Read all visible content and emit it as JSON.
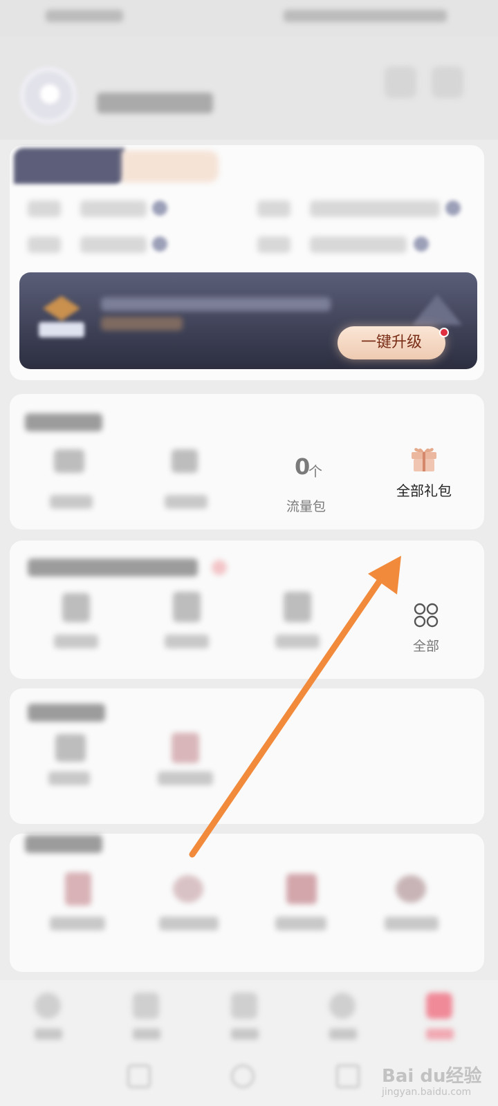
{
  "vip_banner": {
    "upgrade_label": "一键升级"
  },
  "gifts": {
    "traffic_count": "0",
    "traffic_unit": "个",
    "traffic_label": "流量包",
    "all_gifts_label": "全部礼包"
  },
  "services": {
    "all_label": "全部"
  },
  "watermark": {
    "brand": "Bai du经验",
    "url": "jingyan.baidu.com"
  },
  "colors": {
    "accent_orange": "#f28a3c",
    "gift_icon": "#e8b9a0",
    "upgrade_text": "#7a2d17"
  }
}
